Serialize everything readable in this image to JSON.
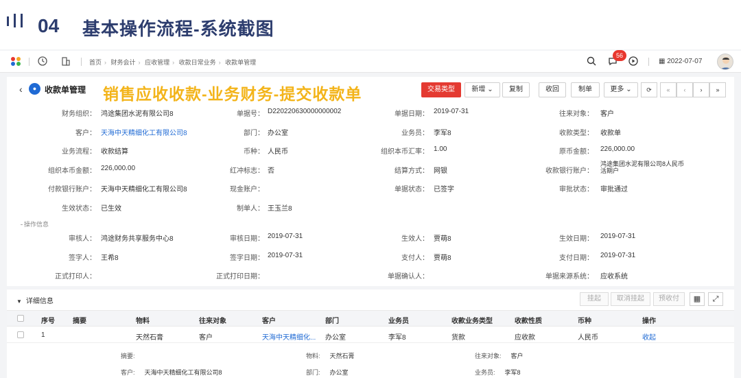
{
  "slide": {
    "number": "04",
    "title": "基本操作流程-系统截图"
  },
  "topbar": {
    "breadcrumbs": [
      "首页",
      "财务会计",
      "应收管理",
      "收款日常业务",
      "收款单管理"
    ],
    "notif_count": "56",
    "date": "2022-07-07"
  },
  "header": {
    "page_title": "收款单管理",
    "overlay": "销售应收收款-业务财务-提交收款单",
    "buttons": {
      "trade_type": "交易类型",
      "new": "新增",
      "copy": "复制",
      "receive": "收回",
      "make": "制单",
      "more": "更多"
    }
  },
  "fields": [
    {
      "label": "财务组织：",
      "value": "鸿途集团水泥有限公司8"
    },
    {
      "label": "单据号：",
      "value": "D220220630000000002"
    },
    {
      "label": "单据日期：",
      "value": "2019-07-31"
    },
    {
      "label": "往来对象：",
      "value": "客户"
    },
    {
      "label": "客户：",
      "value": "天海中天精细化工有限公司8"
    },
    {
      "label": "部门：",
      "value": "办公室"
    },
    {
      "label": "业务员：",
      "value": "李军8"
    },
    {
      "label": "收款类型：",
      "value": "收款单"
    },
    {
      "label": "业务流程：",
      "value": "收款结算"
    },
    {
      "label": "币种：",
      "value": "人民币"
    },
    {
      "label": "组织本币汇率：",
      "value": "1.00"
    },
    {
      "label": "原币金额：",
      "value": "226,000.00"
    },
    {
      "label": "组织本币金额：",
      "value": "226,000.00"
    },
    {
      "label": "红冲标志：",
      "value": "否"
    },
    {
      "label": "结算方式：",
      "value": "网银"
    },
    {
      "label": "收款银行账户：",
      "value": "鸿途集团水泥有限公司8人民币活期户"
    },
    {
      "label": "付款银行账户：",
      "value": "天海中天精细化工有限公司8"
    },
    {
      "label": "现金账户：",
      "value": ""
    },
    {
      "label": "单据状态：",
      "value": "已签字"
    },
    {
      "label": "审批状态：",
      "value": "审批通过"
    },
    {
      "label": "生效状态：",
      "value": "已生效"
    },
    {
      "label": "制单人：",
      "value": "王玉兰8"
    }
  ],
  "operation_section": "操作信息",
  "op_fields": [
    {
      "label": "审核人：",
      "value": "鸿途财务共享服务中心8"
    },
    {
      "label": "审核日期：",
      "value": "2019-07-31"
    },
    {
      "label": "生效人：",
      "value": "贾萌8"
    },
    {
      "label": "生效日期：",
      "value": "2019-07-31"
    },
    {
      "label": "签字人：",
      "value": "王希8"
    },
    {
      "label": "签字日期：",
      "value": "2019-07-31"
    },
    {
      "label": "支付人：",
      "value": "贾萌8"
    },
    {
      "label": "支付日期：",
      "value": "2019-07-31"
    },
    {
      "label": "正式打印人：",
      "value": ""
    },
    {
      "label": "正式打印日期：",
      "value": ""
    },
    {
      "label": "单据确认人：",
      "value": ""
    },
    {
      "label": "单据来源系统：",
      "value": "应收系统"
    }
  ],
  "detail": {
    "title": "详细信息",
    "buttons": {
      "hang": "挂起",
      "cancel_hang": "取消挂起",
      "prepay": "预收付"
    },
    "columns": [
      "序号",
      "摘要",
      "物料",
      "往来对象",
      "客户",
      "部门",
      "业务员",
      "收款业务类型",
      "收款性质",
      "币种",
      "操作"
    ],
    "row": {
      "no": "1",
      "summary": "",
      "material": "天然石膏",
      "party": "客户",
      "customer": "天海中天精细化...",
      "dept": "办公室",
      "salesman": "李军8",
      "biz_type": "货款",
      "nature": "应收款",
      "currency": "人民币",
      "action": "收起"
    },
    "sub": [
      {
        "label": "摘要:",
        "value": ""
      },
      {
        "label": "物料:",
        "value": "天然石膏"
      },
      {
        "label": "往来对象:",
        "value": "客户"
      },
      {
        "label": "客户:",
        "value": "天海中天精细化工有限公司8"
      },
      {
        "label": "部门:",
        "value": "办公室"
      },
      {
        "label": "业务员:",
        "value": "李军8"
      }
    ]
  }
}
